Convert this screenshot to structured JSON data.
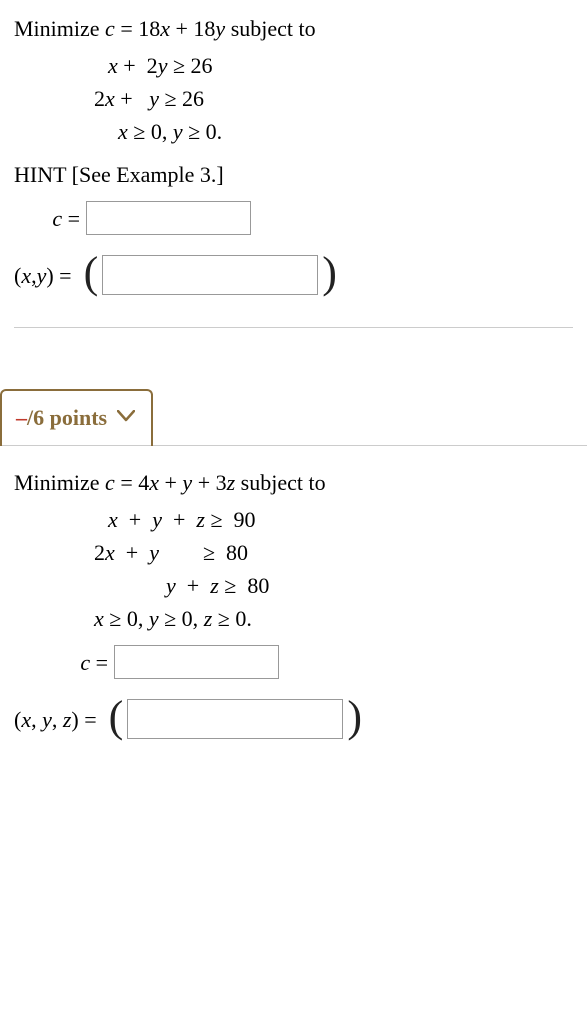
{
  "q1": {
    "prompt_pre": "Minimize ",
    "c": "c",
    "eq": " = ",
    "obj": "18",
    "x": "x",
    "plus": " + ",
    "obj2": "18",
    "y": "y",
    "suffix": " subject to",
    "constraints": {
      "l1_a": "x",
      "l1_b": " +  2",
      "l1_c": "y",
      "l1_d": " ≥ 26",
      "l2_a": "2",
      "l2_b": "x",
      "l2_c": " +   ",
      "l2_d": "y",
      "l2_e": " ≥ 26",
      "l3_a": "x",
      "l3_b": " ≥ 0, ",
      "l3_c": "y",
      "l3_d": " ≥ 0."
    },
    "hint": "HINT [See Example 3.]",
    "c_label_pre": "c",
    "c_label_post": " = ",
    "xy_label": "(",
    "xy_x": "x",
    "xy_comma": ",",
    "xy_y": "y",
    "xy_close": ") = ",
    "c_value": "",
    "xy_value": ""
  },
  "points_tab": {
    "dash": "–",
    "text": "/6 points"
  },
  "q2": {
    "prompt_pre": "Minimize ",
    "c": "c",
    "eq": " = ",
    "a1": "4",
    "x": "x",
    "plus": " + ",
    "y": "y",
    "a3": "3",
    "z": "z",
    "suffix": " subject to",
    "constraints": {
      "l1_a": "x",
      "l1_b": "  +  ",
      "l1_c": "y",
      "l1_d": "  +  ",
      "l1_e": "z",
      "l1_f": " ≥  90",
      "l2_a": "2",
      "l2_b": "x",
      "l2_c": "  +  ",
      "l2_d": "y",
      "l2_e": "        ≥  80",
      "l3_a": "y",
      "l3_b": "  +  ",
      "l3_c": "z",
      "l3_d": " ≥  80",
      "l4_a": "x",
      "l4_b": " ≥ 0, ",
      "l4_c": "y",
      "l4_d": " ≥ 0, ",
      "l4_e": "z",
      "l4_f": " ≥ 0."
    },
    "c_label_pre": "c",
    "c_label_post": " = ",
    "xyz_open": "(",
    "xyz_x": "x",
    "xyz_c1": ", ",
    "xyz_y": "y",
    "xyz_c2": ", ",
    "xyz_z": "z",
    "xyz_close": ") = ",
    "c_value": "",
    "xyz_value": ""
  }
}
